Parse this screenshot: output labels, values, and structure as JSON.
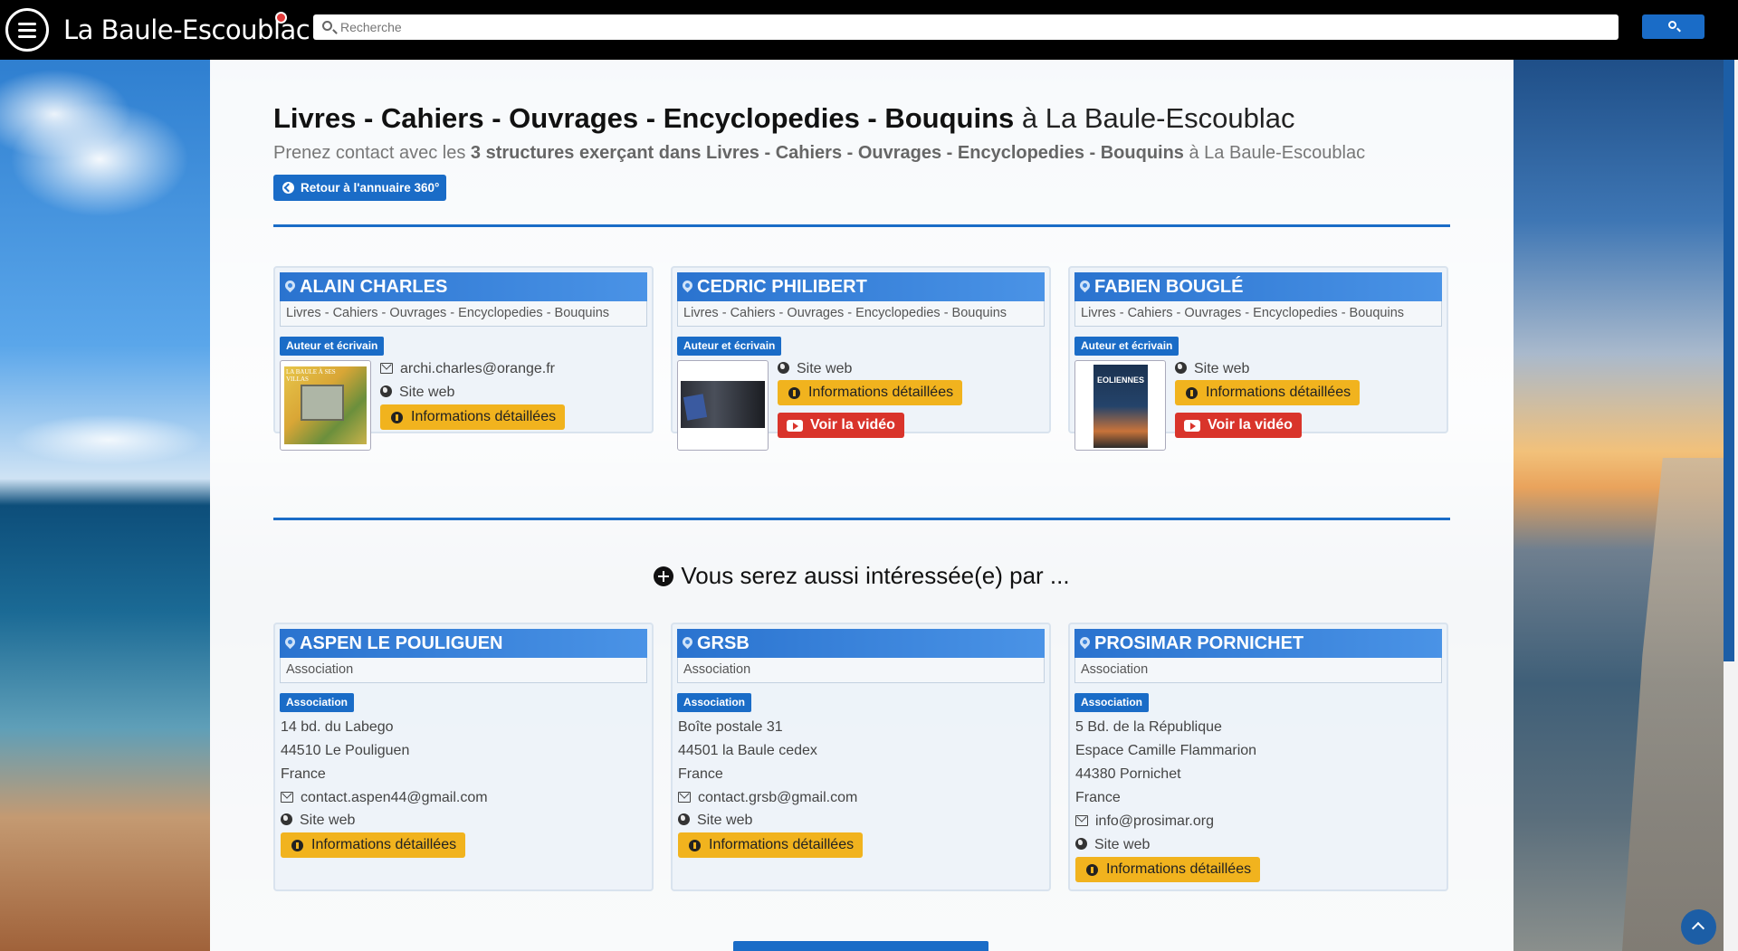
{
  "header": {
    "site_title": "La Baule-Escoublac",
    "search_placeholder": "Recherche"
  },
  "page": {
    "title_bold": "Livres - Cahiers - Ouvrages - Encyclopedies - Bouquins",
    "title_rest": " à La Baule-Escoublac",
    "subtitle_start": "Prenez contact avec les ",
    "subtitle_bold": "3 structures exerçant dans Livres - Cahiers - Ouvrages - Encyclopedies - Bouquins",
    "subtitle_end": " à La Baule-Escoublac",
    "back_button": "Retour à l'annuaire 360°",
    "also_heading": "Vous serez aussi intéressée(e) par ..."
  },
  "main_cards": [
    {
      "name": "ALAIN CHARLES",
      "category": "Livres - Cahiers - Ouvrages - Encyclopedies - Bouquins",
      "tag": "Auteur et écrivain",
      "email": "archi.charles@orange.fr",
      "website": "Site web",
      "info_button": "Informations détaillées",
      "thumb_text": "LA BAULE À SES VILLAS"
    },
    {
      "name": "CEDRIC PHILIBERT",
      "category": "Livres - Cahiers - Ouvrages - Encyclopedies - Bouquins",
      "tag": "Auteur et écrivain",
      "website": "Site web",
      "info_button": "Informations détaillées",
      "video_button": "Voir la vidéo"
    },
    {
      "name": "FABIEN BOUGLÉ",
      "category": "Livres - Cahiers - Ouvrages - Encyclopedies - Bouquins",
      "tag": "Auteur et écrivain",
      "website": "Site web",
      "info_button": "Informations détaillées",
      "video_button": "Voir la vidéo",
      "thumb_text": "EOLIENNES"
    }
  ],
  "related_cards": [
    {
      "name": "ASPEN LE POULIGUEN",
      "category": "Association",
      "tag": "Association",
      "address": [
        "14 bd. du Labego",
        "44510 Le Pouliguen",
        "France"
      ],
      "email": "contact.aspen44@gmail.com",
      "website": "Site web",
      "info_button": "Informations détaillées"
    },
    {
      "name": "GRSB",
      "category": "Association",
      "tag": "Association",
      "address": [
        "Boîte postale 31",
        "44501 la Baule cedex",
        "France"
      ],
      "email": "contact.grsb@gmail.com",
      "website": "Site web",
      "info_button": "Informations détaillées"
    },
    {
      "name": "PROSIMAR PORNICHET",
      "category": "Association",
      "tag": "Association",
      "address": [
        "5 Bd. de la République",
        "Espace Camille Flammarion",
        "44380 Pornichet",
        "France"
      ],
      "email": "info@prosimar.org",
      "website": "Site web",
      "info_button": "Informations détaillées"
    }
  ],
  "colors": {
    "accent": "#1a6cc7",
    "info_button": "#f1b31e",
    "video_button": "#d9342b",
    "card_header": "#2a73cf"
  }
}
